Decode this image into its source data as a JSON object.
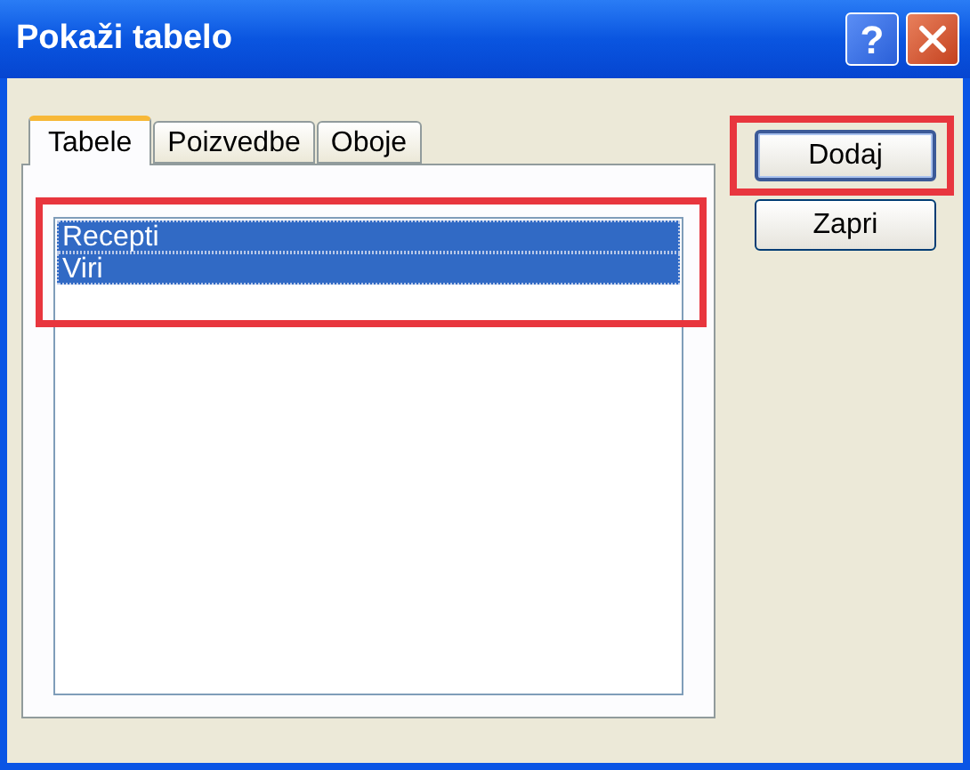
{
  "window": {
    "title": "Pokaži tabelo",
    "title_buttons": [
      {
        "kind": "help",
        "label": "?"
      },
      {
        "kind": "close"
      }
    ]
  },
  "tabs": [
    {
      "label": "Tabele",
      "selected": true
    },
    {
      "label": "Poizvedbe",
      "selected": false
    },
    {
      "label": "Oboje",
      "selected": false
    }
  ],
  "list": {
    "highlight": true,
    "items": [
      {
        "label": "Recepti",
        "selected": true
      },
      {
        "label": "Viri",
        "selected": true
      }
    ]
  },
  "buttons": [
    {
      "label": "Dodaj",
      "default": true,
      "highlight": true
    },
    {
      "label": "Zapri",
      "default": false,
      "highlight": false
    }
  ]
}
